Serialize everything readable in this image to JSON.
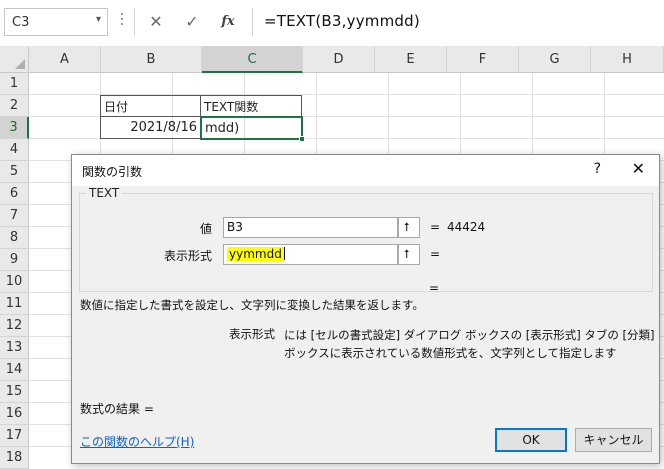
{
  "formula_bar": {
    "name_box": "C3",
    "formula_text": "=TEXT(B3,yymmdd)",
    "cancel_icon": "✕",
    "enter_icon": "✓",
    "fx_label": "fx",
    "dropdown_icon": "▾"
  },
  "columns": [
    "A",
    "B",
    "C",
    "D",
    "E",
    "F",
    "G",
    "H"
  ],
  "rows": [
    "1",
    "2",
    "3",
    "4",
    "5",
    "6",
    "7",
    "8",
    "9",
    "10",
    "11",
    "12",
    "13",
    "14",
    "15",
    "16",
    "17",
    "18"
  ],
  "selected_column": "C",
  "selected_row": "3",
  "cells": {
    "B2": "日付",
    "C2": "TEXT関数",
    "B3": "2021/8/16",
    "C3": "mdd)"
  },
  "dialog": {
    "title": "関数の引数",
    "help_button": "?",
    "close_button": "✕",
    "function_name": "TEXT",
    "args": [
      {
        "label": "値",
        "value": "B3",
        "equals": "=",
        "result": "44424"
      },
      {
        "label": "表示形式",
        "value": "yymmdd",
        "equals": "=",
        "result": ""
      }
    ],
    "overall_equals": "=",
    "description": "数値に指定した書式を設定し、文字列に変換した結果を返します。",
    "arg_description_name": "表示形式",
    "arg_description_text": "には [セルの書式設定] ダイアログ ボックスの [表示形式] タブの [分類] ボックスに表示されている数値形式を、文字列として指定します",
    "result_label": "数式の結果 =",
    "help_link": "この関数のヘルプ(H)",
    "ok_label": "OK",
    "cancel_label": "キャンセル",
    "collapse_icon": "⭡"
  }
}
